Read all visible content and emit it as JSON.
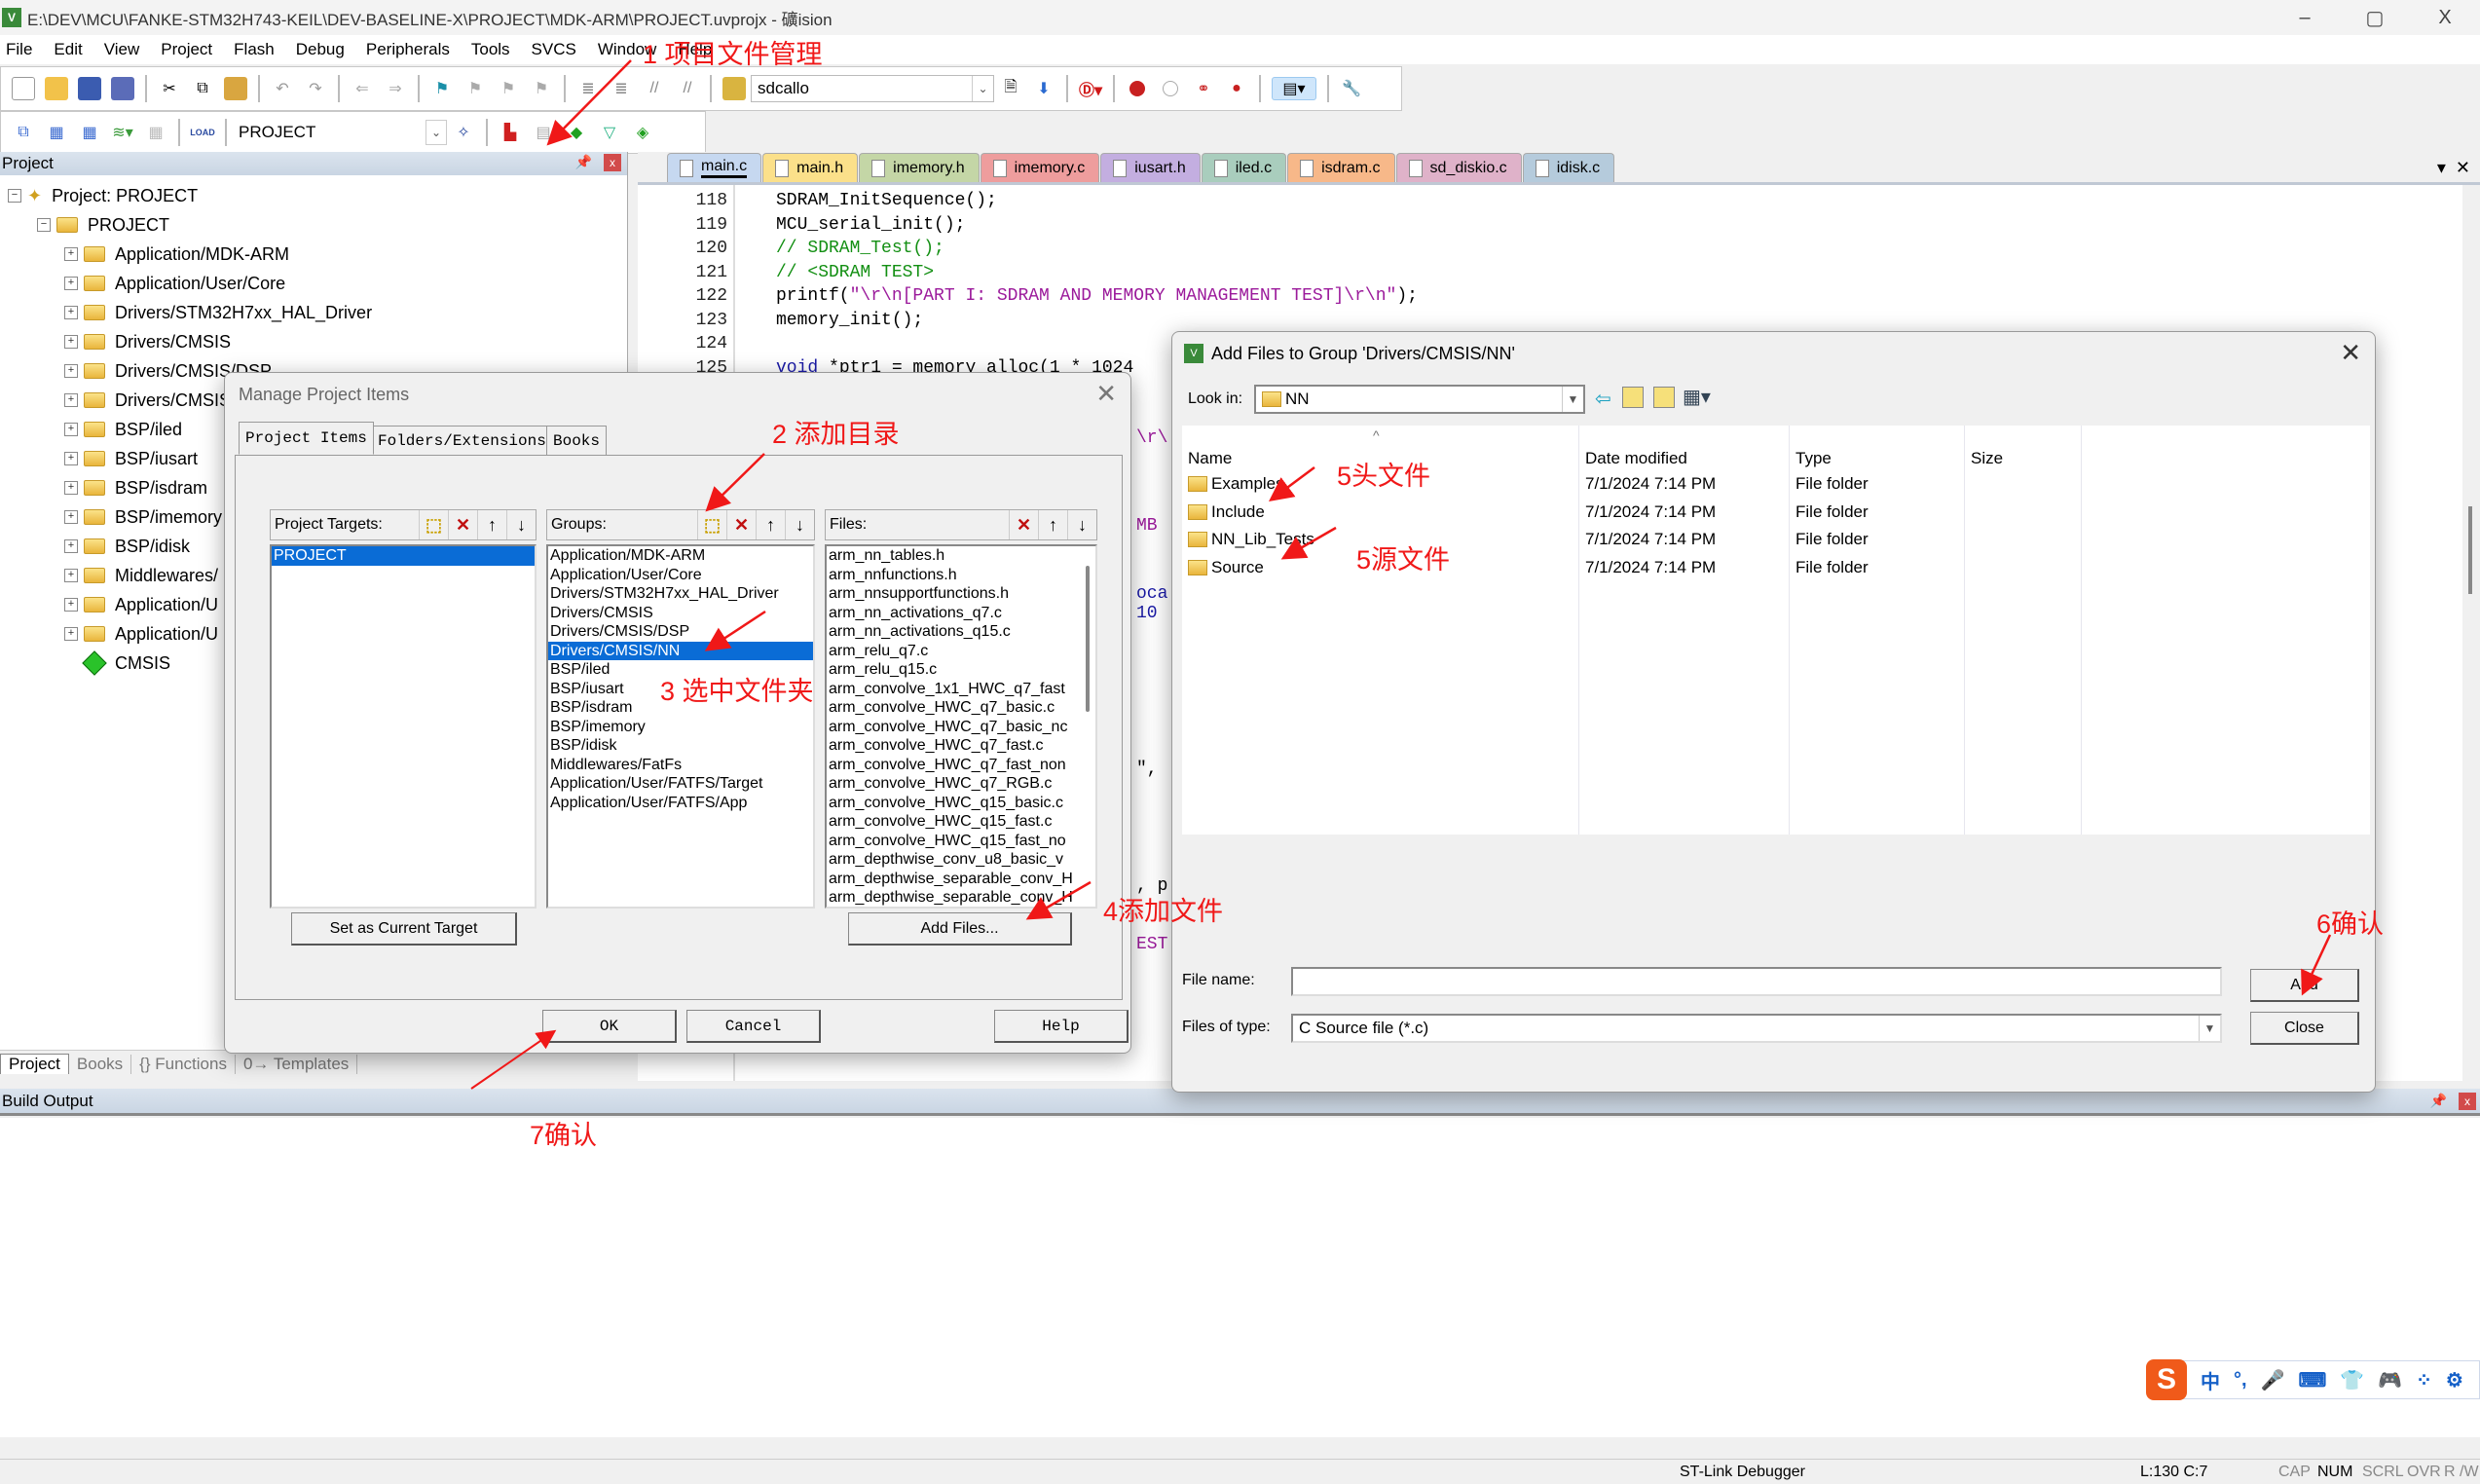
{
  "window": {
    "title": "E:\\DEV\\MCU\\FANKE-STM32H743-KEIL\\DEV-BASELINE-X\\PROJECT\\MDK-ARM\\PROJECT.uvprojx - 礦ision",
    "app_icon": "keil-uvision-icon",
    "controls": {
      "minimize": "–",
      "maximize": "▢",
      "close": "X"
    }
  },
  "menu": [
    "File",
    "Edit",
    "View",
    "Project",
    "Flash",
    "Debug",
    "Peripherals",
    "Tools",
    "SVCS",
    "Window",
    "Help"
  ],
  "toolbar1": {
    "find_combo_value": "sdcallo",
    "icons": [
      "new-file-icon",
      "open-file-icon",
      "save-icon",
      "save-all-icon",
      "cut-icon",
      "copy-icon",
      "paste-icon",
      "undo-icon",
      "redo-icon",
      "nav-back-icon",
      "nav-forward-icon",
      "bookmark-icon",
      "prev-bookmark-icon",
      "next-bookmark-icon",
      "clear-bookmarks-icon",
      "indent-icon",
      "unindent-icon",
      "comment-icon",
      "uncomment-icon",
      "find-in-files-icon",
      "find-icon",
      "incremental-find-icon",
      "debug-session-icon",
      "breakpoint-icon",
      "disable-breakpoint-icon",
      "disable-all-breakpoints-icon",
      "kill-all-breakpoints-icon",
      "window-layout-icon",
      "configure-icon"
    ]
  },
  "toolbar2": {
    "target_combo_value": "PROJECT",
    "load_label": "LOAD",
    "icons": [
      "translate-icon",
      "build-icon",
      "rebuild-icon",
      "batch-build-icon",
      "stop-build-icon",
      "download-icon",
      "options-icon",
      "manage-project-items-icon",
      "select-packs-icon",
      "manage-rte-icon",
      "event-recorder-icon",
      "pack-installer-icon"
    ]
  },
  "project_panel": {
    "header": "Project",
    "root": "Project: PROJECT",
    "target": "PROJECT",
    "groups": [
      "Application/MDK-ARM",
      "Application/User/Core",
      "Drivers/STM32H7xx_HAL_Driver",
      "Drivers/CMSIS",
      "Drivers/CMSIS/DSP",
      "Drivers/CMSIS",
      "BSP/iled",
      "BSP/iusart",
      "BSP/isdram",
      "BSP/imemory",
      "BSP/idisk",
      "Middlewares/",
      "Application/U",
      "Application/U"
    ],
    "cmsis": "CMSIS",
    "bottom_tabs": [
      "Project",
      "Books",
      "{} Functions",
      "0→ Templates"
    ]
  },
  "editor": {
    "tabs": [
      {
        "label": "main.c",
        "color": "#c6d8f0",
        "active": true
      },
      {
        "label": "main.h",
        "color": "#fbe08a"
      },
      {
        "label": "imemory.h",
        "color": "#c4d6a6"
      },
      {
        "label": "imemory.c",
        "color": "#ee9d9d"
      },
      {
        "label": "iusart.h",
        "color": "#c3aee0"
      },
      {
        "label": "iled.c",
        "color": "#a9cdbd"
      },
      {
        "label": "isdram.c",
        "color": "#f7b889"
      },
      {
        "label": "sd_diskio.c",
        "color": "#dfb2c9"
      },
      {
        "label": "idisk.c",
        "color": "#b5cbdc"
      }
    ],
    "lines": [
      {
        "n": "118",
        "parts": [
          {
            "t": "SDRAM_InitSequence();",
            "c": ""
          }
        ]
      },
      {
        "n": "119",
        "parts": [
          {
            "t": "MCU_serial_init();",
            "c": ""
          }
        ]
      },
      {
        "n": "120",
        "parts": [
          {
            "t": "// SDRAM_Test();",
            "c": "cm"
          }
        ]
      },
      {
        "n": "121",
        "parts": [
          {
            "t": "// <SDRAM TEST>",
            "c": "cm"
          }
        ]
      },
      {
        "n": "122",
        "parts": [
          {
            "t": "printf(",
            "c": ""
          },
          {
            "t": "\"\\r\\n[PART I: SDRAM AND MEMORY MANAGEMENT TEST]\\r\\n\"",
            "c": "st"
          },
          {
            "t": ");",
            "c": ""
          }
        ]
      },
      {
        "n": "123",
        "parts": [
          {
            "t": "memory_init();",
            "c": ""
          }
        ]
      },
      {
        "n": "124",
        "parts": [
          {
            "t": "",
            "c": ""
          }
        ]
      },
      {
        "n": "125",
        "parts": [
          {
            "t": "void",
            "c": "kw"
          },
          {
            "t": " *ptr1 = memory_alloc(1 * 1024",
            "c": ""
          }
        ]
      }
    ],
    "peek_fragments": [
      "\\r\\",
      "MB",
      "oca",
      "10",
      "\",",
      ", p",
      "EST"
    ]
  },
  "manage_dialog": {
    "title": "Manage Project Items",
    "tabs": [
      "Project Items",
      "Folders/Extensions",
      "Books"
    ],
    "targets_label": "Project Targets:",
    "targets": [
      "PROJECT"
    ],
    "groups_label": "Groups:",
    "groups": [
      "Application/MDK-ARM",
      "Application/User/Core",
      "Drivers/STM32H7xx_HAL_Driver",
      "Drivers/CMSIS",
      "Drivers/CMSIS/DSP",
      "Drivers/CMSIS/NN",
      "BSP/iled",
      "BSP/iusart",
      "BSP/isdram",
      "BSP/imemory",
      "BSP/idisk",
      "Middlewares/FatFs",
      "Application/User/FATFS/Target",
      "Application/User/FATFS/App"
    ],
    "selected_group": "Drivers/CMSIS/NN",
    "files_label": "Files:",
    "files": [
      "arm_nn_tables.h",
      "arm_nnfunctions.h",
      "arm_nnsupportfunctions.h",
      "arm_nn_activations_q7.c",
      "arm_nn_activations_q15.c",
      "arm_relu_q7.c",
      "arm_relu_q15.c",
      "arm_convolve_1x1_HWC_q7_fast",
      "arm_convolve_HWC_q7_basic.c",
      "arm_convolve_HWC_q7_basic_nc",
      "arm_convolve_HWC_q7_fast.c",
      "arm_convolve_HWC_q7_fast_non",
      "arm_convolve_HWC_q7_RGB.c",
      "arm_convolve_HWC_q15_basic.c",
      "arm_convolve_HWC_q15_fast.c",
      "arm_convolve_HWC_q15_fast_no",
      "arm_depthwise_conv_u8_basic_v",
      "arm_depthwise_separable_conv_H",
      "arm_depthwise_separable_conv_H"
    ],
    "set_current_label": "Set as Current Target",
    "add_files_label": "Add Files...",
    "ok_label": "OK",
    "cancel_label": "Cancel",
    "help_label": "Help"
  },
  "add_files_dialog": {
    "title": "Add Files to Group 'Drivers/CMSIS/NN'",
    "look_in_label": "Look in:",
    "look_in_value": "NN",
    "columns": [
      "Name",
      "Date modified",
      "Type",
      "Size"
    ],
    "rows": [
      {
        "name": "Examples",
        "date": "7/1/2024 7:14 PM",
        "type": "File folder",
        "size": ""
      },
      {
        "name": "Include",
        "date": "7/1/2024 7:14 PM",
        "type": "File folder",
        "size": ""
      },
      {
        "name": "NN_Lib_Tests",
        "date": "7/1/2024 7:14 PM",
        "type": "File folder",
        "size": ""
      },
      {
        "name": "Source",
        "date": "7/1/2024 7:14 PM",
        "type": "File folder",
        "size": ""
      }
    ],
    "file_name_label": "File name:",
    "file_name_value": "",
    "files_of_type_label": "Files of type:",
    "files_of_type_value": "C Source file (*.c)",
    "add_label": "Add",
    "close_label": "Close"
  },
  "build_output": {
    "header": "Build Output"
  },
  "status_bar": {
    "debugger": "ST-Link Debugger",
    "position": "L:130 C:7",
    "indicators": [
      "CAP",
      "NUM",
      "SCRL",
      "OVR",
      "R /W"
    ]
  },
  "ime_toolbar": {
    "logo": "S",
    "items": [
      "中",
      "°,",
      "🎤",
      "⌨",
      "👕",
      "🎮",
      "⁘",
      "⚙"
    ]
  },
  "annotations": {
    "a1": "1 项目文件管理",
    "a2": "2 添加目录",
    "a3": "3 选中文件夹",
    "a4": "4添加文件",
    "a5h": "5头文件",
    "a5s": "5源文件",
    "a6": "6确认",
    "a7": "7确认",
    "color": "#f01818"
  }
}
